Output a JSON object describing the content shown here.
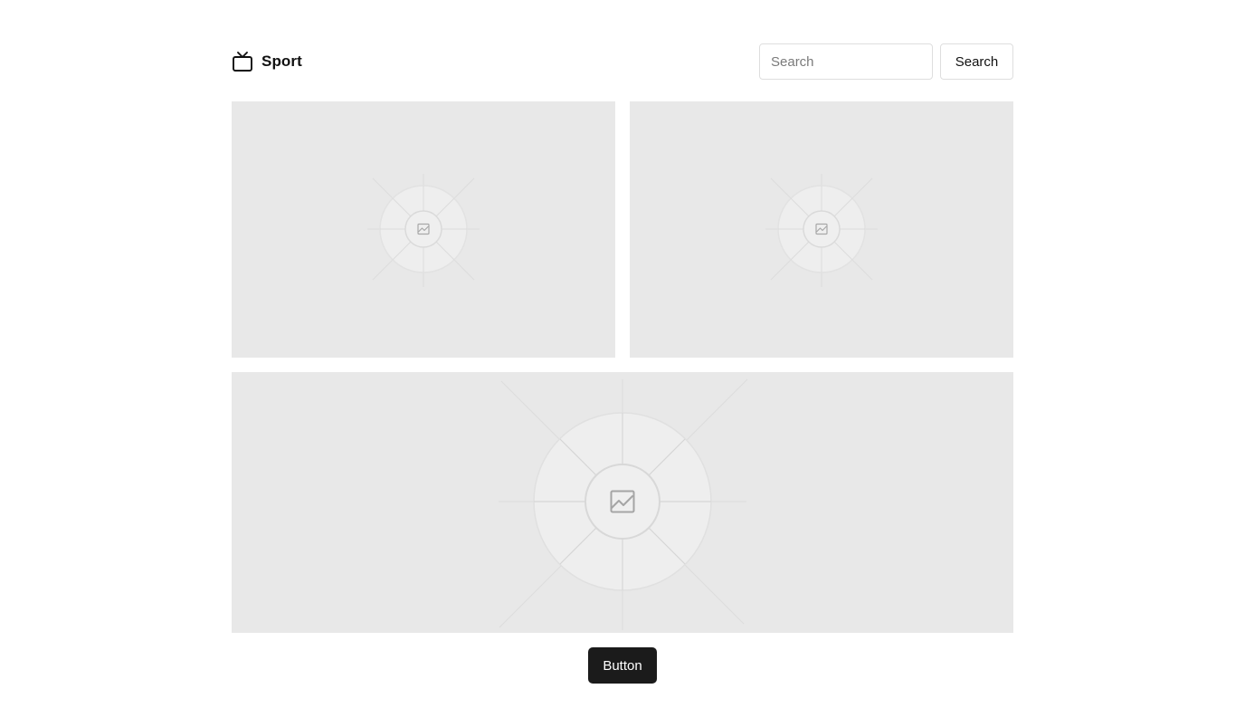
{
  "header": {
    "brand_icon": "tv-icon",
    "brand_title": "Sport",
    "search": {
      "placeholder": "Search",
      "value": "",
      "button_label": "Search"
    }
  },
  "media": [
    {
      "icon": "image-placeholder-icon"
    },
    {
      "icon": "image-placeholder-icon"
    },
    {
      "icon": "image-placeholder-icon"
    }
  ],
  "footer": {
    "button_label": "Button",
    "button_color": "#1b1b1b"
  },
  "colors": {
    "placeholder_bg": "#e8e8e8",
    "border": "#dedede"
  }
}
